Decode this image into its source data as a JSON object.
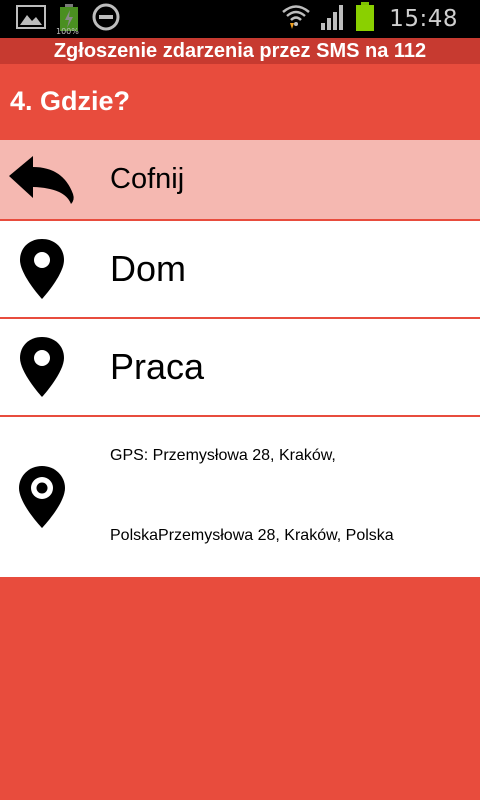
{
  "status_bar": {
    "time": "15:48",
    "battery_percent_label": "100%",
    "icons": [
      "image-icon",
      "battery-icon",
      "do-not-disturb-icon",
      "wifi-icon",
      "signal-icon",
      "battery-icon"
    ]
  },
  "app": {
    "title": "Zgłoszenie zdarzenia przez SMS na 112"
  },
  "section": {
    "title": "4. Gdzie?"
  },
  "list": {
    "back": {
      "label": "Cofnij",
      "icon": "back-arrow-icon"
    },
    "items": [
      {
        "label": "Dom",
        "icon": "map-pin-icon"
      },
      {
        "label": "Praca",
        "icon": "map-pin-icon"
      }
    ],
    "gps": {
      "line1": "GPS: Przemysłowa 28, Kraków,",
      "line2": "PolskaPrzemysłowa 28, Kraków, Polska",
      "icon": "gps-pin-icon"
    }
  },
  "colors": {
    "accent": "#e84c3d",
    "title_bar": "#c73a30",
    "back_row": "#f5b8b1",
    "row_bg": "#ffffff"
  }
}
